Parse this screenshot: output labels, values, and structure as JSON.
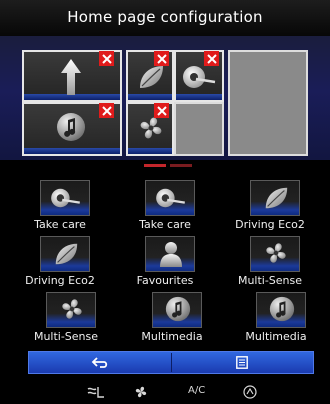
{
  "header": {
    "title": "Home page configuration"
  },
  "preview": {
    "icons": [
      "up-arrow-icon",
      "multimedia-icon",
      "driving-eco-icon",
      "take-care-icon",
      "multi-sense-icon"
    ],
    "remove_icon": "close-icon"
  },
  "shortcuts": [
    {
      "label": "Take care",
      "icon": "take-care-icon"
    },
    {
      "label": "Take care",
      "icon": "take-care-icon"
    },
    {
      "label": "Driving Eco2",
      "icon": "driving-eco-icon"
    },
    {
      "label": "Driving Eco2",
      "icon": "driving-eco-icon"
    },
    {
      "label": "Favourites",
      "icon": "favourites-icon"
    },
    {
      "label": "Multi-Sense",
      "icon": "multi-sense-icon"
    },
    {
      "label": "Multi-Sense",
      "icon": "multi-sense-icon"
    },
    {
      "label": "Multimedia",
      "icon": "multimedia-icon"
    },
    {
      "label": "Multimedia",
      "icon": "multimedia-icon"
    }
  ],
  "bottom_bar": {
    "back_icon": "back-icon",
    "menu_icon": "menu-icon"
  },
  "status_bar": {
    "ac_label": "A/C",
    "icons": [
      "seat-ventilation-icon",
      "fan-icon",
      "recirculation-icon"
    ]
  },
  "colors": {
    "accent_blue": "#2a56d6",
    "remove_red": "#e01b1b",
    "scroll_red": "#c3262b"
  }
}
